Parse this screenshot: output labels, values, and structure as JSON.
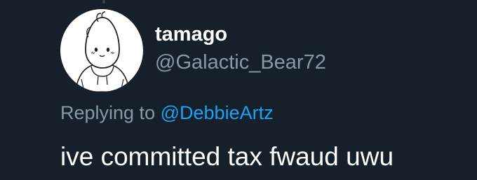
{
  "tweet": {
    "author": {
      "display_name": "tamago",
      "handle": "@Galactic_Bear72",
      "avatar_icon": "cartoon-egg-character-avatar"
    },
    "reply": {
      "prefix": "Replying to",
      "mention": "@DebbieArtz"
    },
    "text": "ive committed tax fwaud uwu"
  },
  "colors": {
    "background": "#15202b",
    "primary_text": "#ffffff",
    "secondary_text": "#8899a6",
    "link": "#1da1f2"
  }
}
